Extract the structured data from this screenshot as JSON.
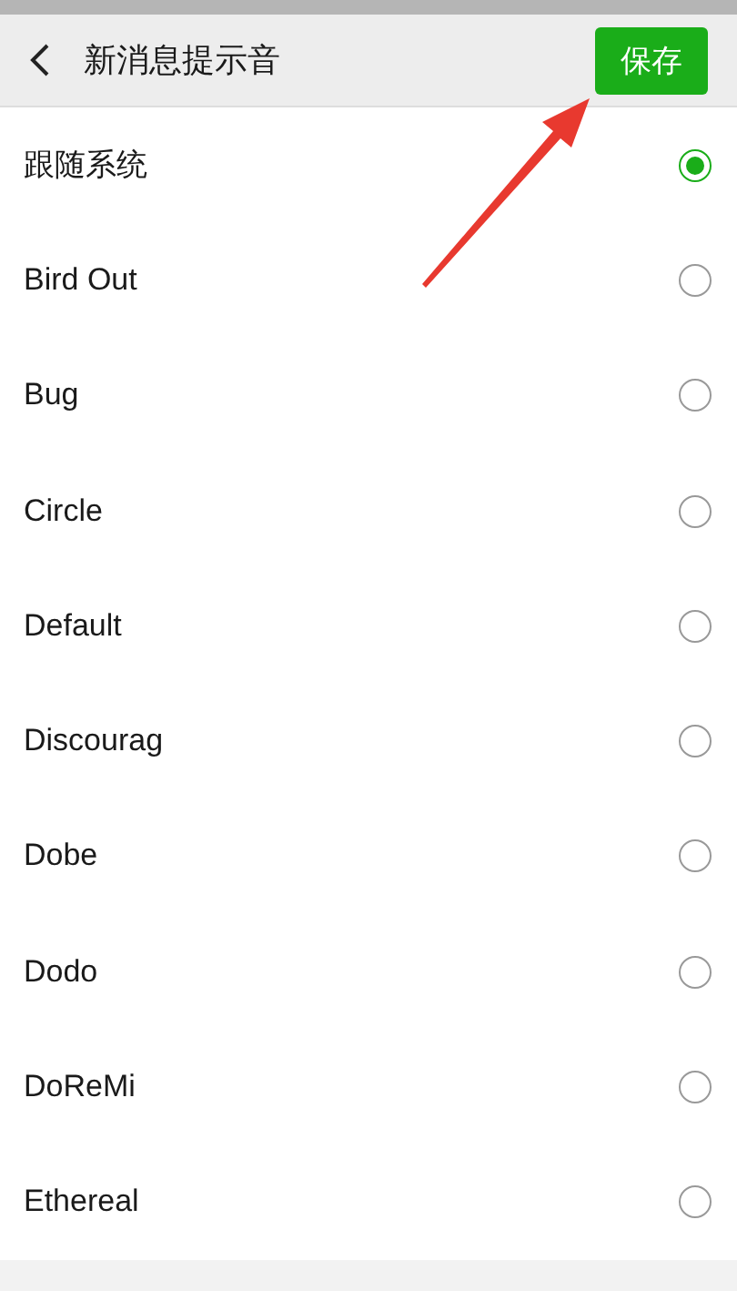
{
  "header": {
    "title": "新消息提示音",
    "save_button": "保存"
  },
  "options": [
    {
      "label": "跟随系统",
      "selected": true
    },
    {
      "label": "Bird Out",
      "selected": false
    },
    {
      "label": "Bug",
      "selected": false
    },
    {
      "label": "Circle",
      "selected": false
    },
    {
      "label": "Default",
      "selected": false
    },
    {
      "label": "Discourag",
      "selected": false
    },
    {
      "label": "Dobe",
      "selected": false
    },
    {
      "label": "Dodo",
      "selected": false
    },
    {
      "label": "DoReMi",
      "selected": false
    },
    {
      "label": "Ethereal",
      "selected": false
    }
  ]
}
